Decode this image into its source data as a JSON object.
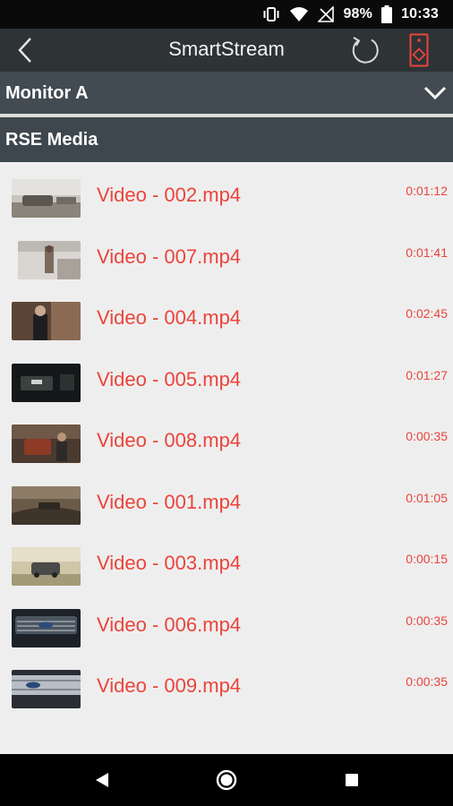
{
  "status_bar": {
    "battery_percent": "98%",
    "time": "10:33",
    "icons": [
      "vibrate-icon",
      "wifi-icon",
      "no-signal-icon",
      "battery-icon"
    ]
  },
  "app_bar": {
    "title": "SmartStream",
    "icons": [
      "back-arrow-icon",
      "refresh-icon",
      "remote-control-icon"
    ],
    "accent_color": "#e8453c"
  },
  "monitor": {
    "label": "Monitor A",
    "icon": "chevron-down-icon"
  },
  "media_section": {
    "label": "RSE Media"
  },
  "media_items": [
    {
      "title": "Video - 002.mp4",
      "duration": "0:01:12"
    },
    {
      "title": "Video - 007.mp4",
      "duration": "0:01:41"
    },
    {
      "title": "Video - 004.mp4",
      "duration": "0:02:45"
    },
    {
      "title": "Video - 005.mp4",
      "duration": "0:01:27"
    },
    {
      "title": "Video - 008.mp4",
      "duration": "0:00:35"
    },
    {
      "title": "Video - 001.mp4",
      "duration": "0:01:05"
    },
    {
      "title": "Video - 003.mp4",
      "duration": "0:00:15"
    },
    {
      "title": "Video - 006.mp4",
      "duration": "0:00:35"
    },
    {
      "title": "Video - 009.mp4",
      "duration": "0:00:35"
    }
  ],
  "nav_bar": {
    "icons": [
      "back-triangle-icon",
      "home-circle-icon",
      "recents-square-icon"
    ]
  },
  "colors": {
    "title_red": "#e8453c",
    "header_bg": "#414b51",
    "app_bar_bg": "#2e3336",
    "list_bg": "#efeeee"
  }
}
